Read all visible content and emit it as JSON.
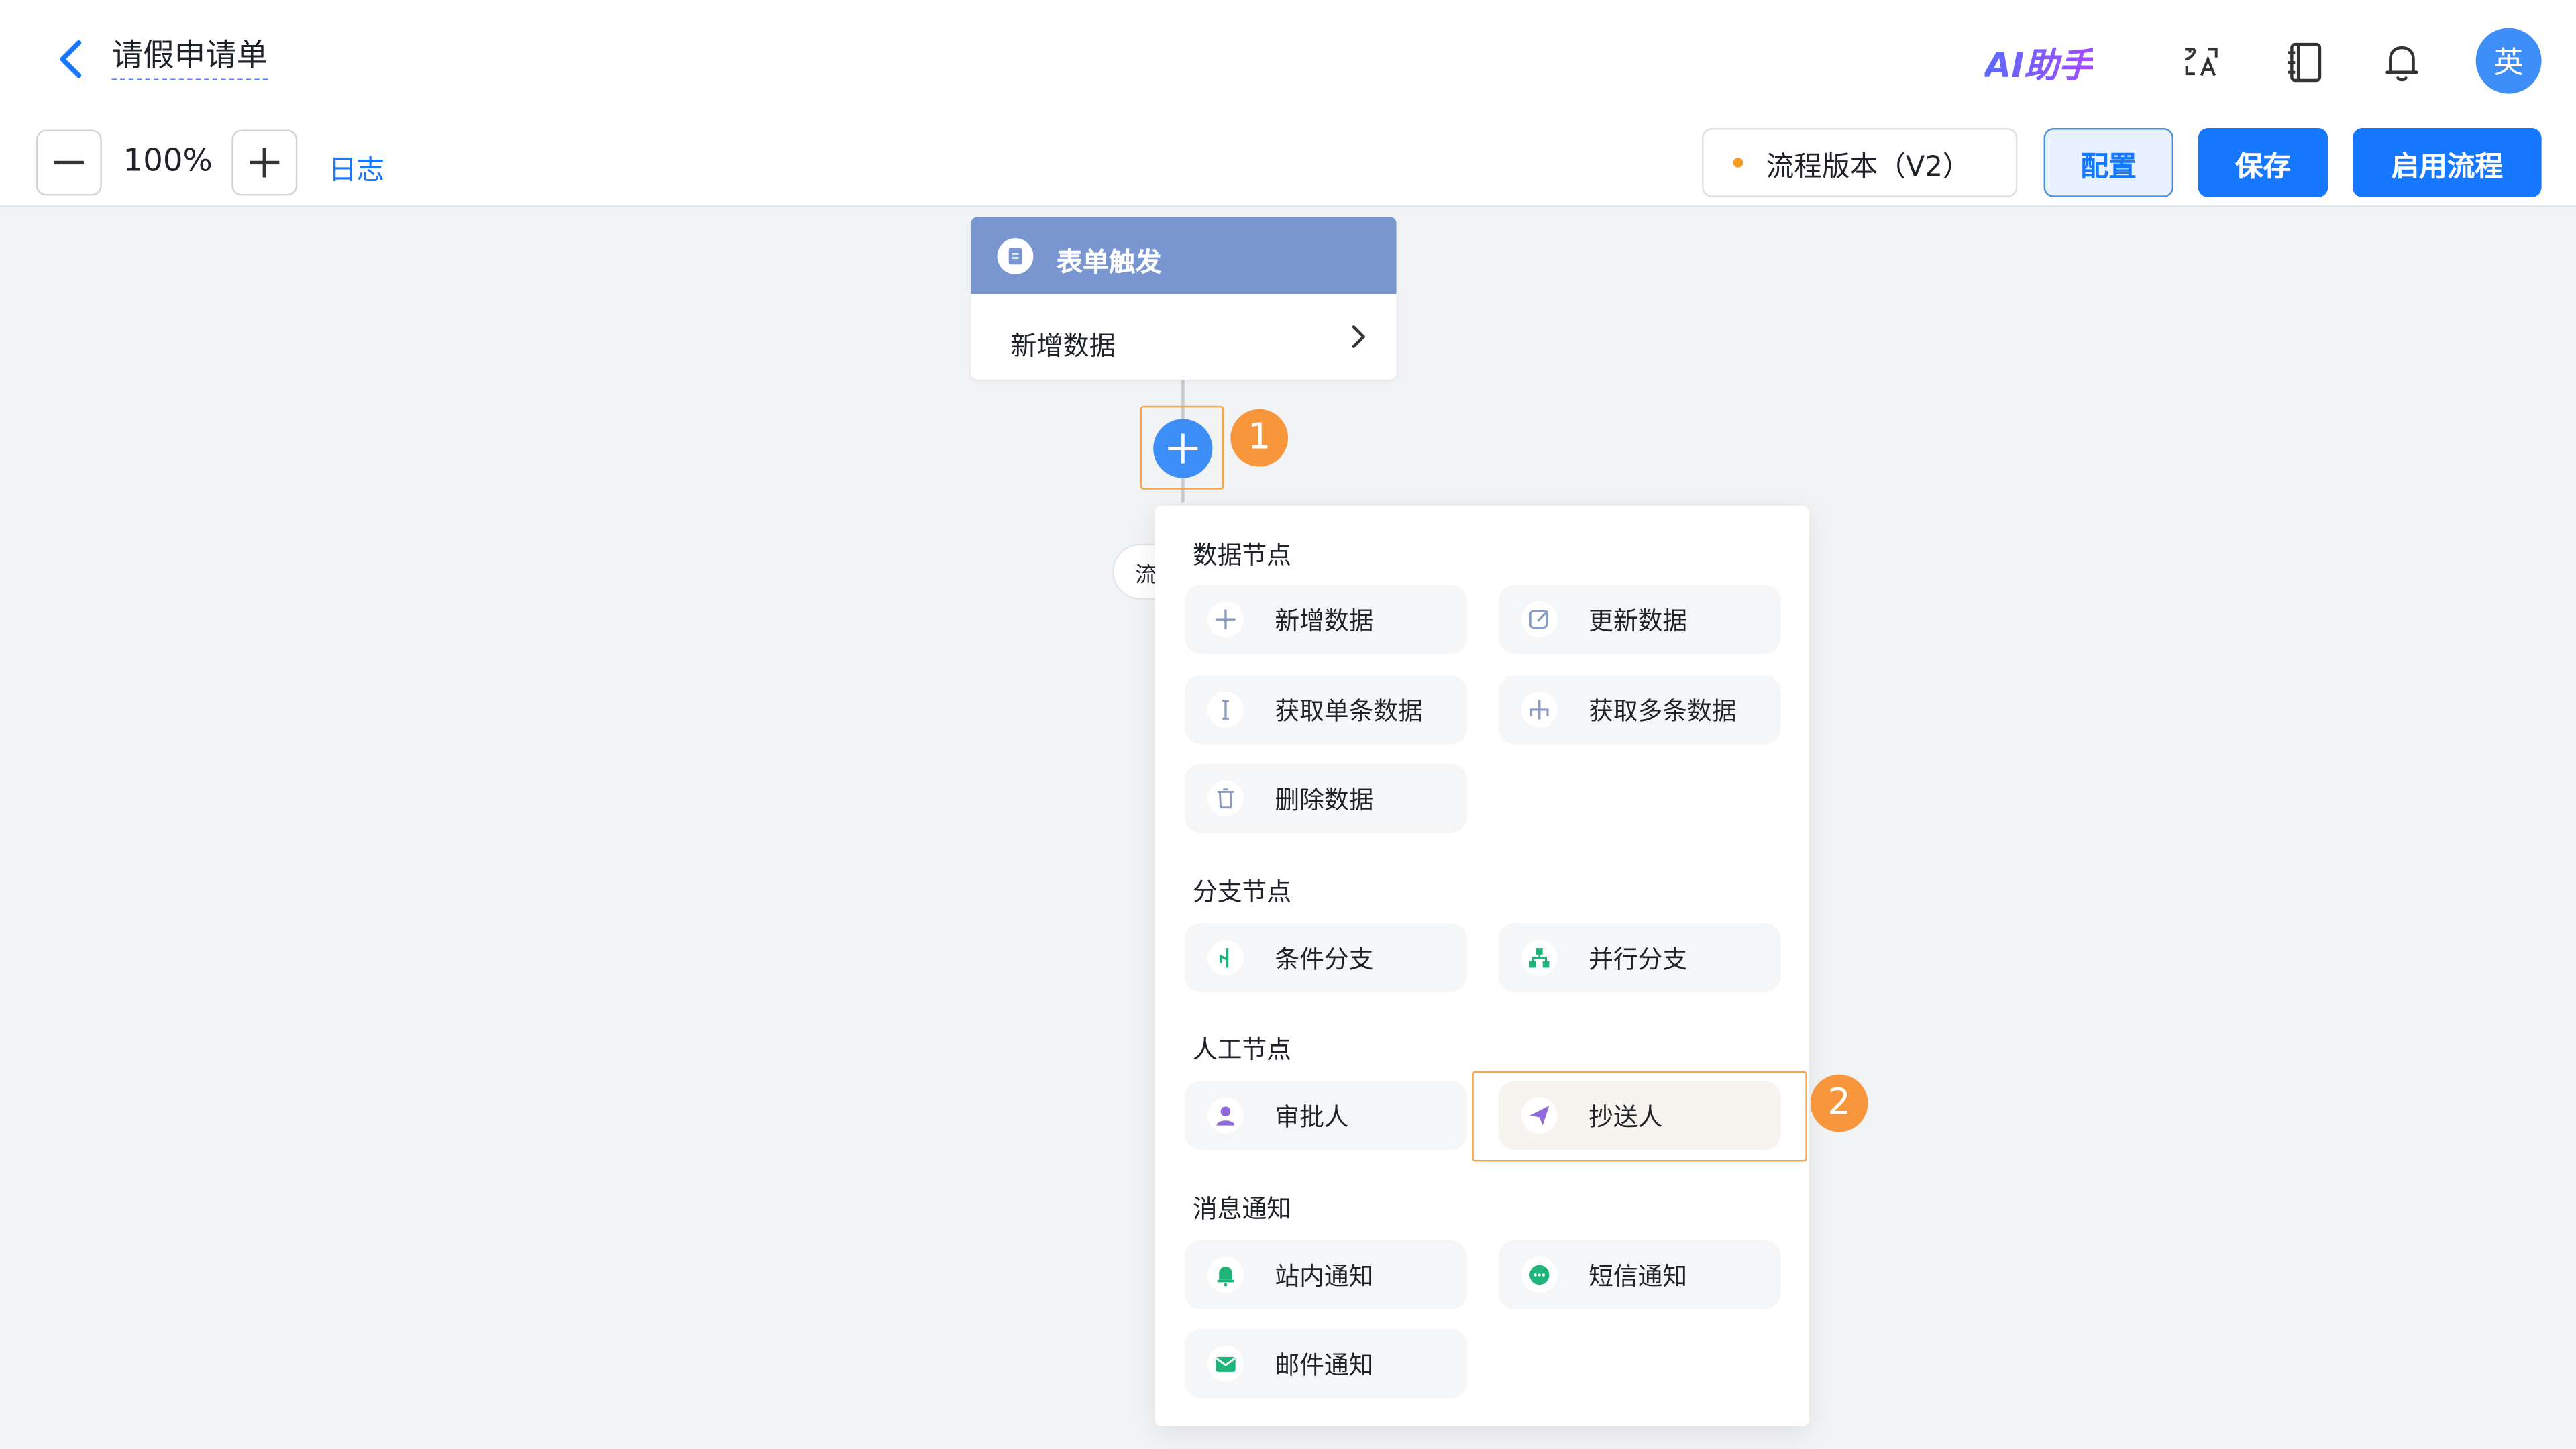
{
  "header": {
    "title": "请假申请单",
    "ai_assistant": "AI助手",
    "avatar_text": "英"
  },
  "toolbar": {
    "zoom_level": "100%",
    "log_label": "日志",
    "version_label": "流程版本（V2）",
    "config_label": "配置",
    "save_label": "保存",
    "enable_label": "启用流程"
  },
  "trigger_node": {
    "title": "表单触发",
    "action": "新增数据"
  },
  "annotations": {
    "step1": "1",
    "step2": "2"
  },
  "hidden_pill_text": "流",
  "menu": {
    "sections": [
      {
        "title": "数据节点",
        "items": [
          {
            "label": "新增数据",
            "icon": "plus-icon"
          },
          {
            "label": "更新数据",
            "icon": "edit-icon"
          },
          {
            "label": "获取单条数据",
            "icon": "single-line-icon"
          },
          {
            "label": "获取多条数据",
            "icon": "multi-branch-icon"
          },
          {
            "label": "删除数据",
            "icon": "trash-icon"
          }
        ]
      },
      {
        "title": "分支节点",
        "items": [
          {
            "label": "条件分支",
            "icon": "condition-branch-icon"
          },
          {
            "label": "并行分支",
            "icon": "parallel-branch-icon"
          }
        ]
      },
      {
        "title": "人工节点",
        "items": [
          {
            "label": "审批人",
            "icon": "user-icon"
          },
          {
            "label": "抄送人",
            "icon": "send-icon"
          }
        ]
      },
      {
        "title": "消息通知",
        "items": [
          {
            "label": "站内通知",
            "icon": "bell-icon"
          },
          {
            "label": "短信通知",
            "icon": "chat-icon"
          },
          {
            "label": "邮件通知",
            "icon": "mail-icon"
          }
        ]
      }
    ]
  },
  "colors": {
    "primary": "#1677ff",
    "trigger_header": "#7a96d0",
    "highlight": "#f7a54a",
    "data_icon": "#8a9bc4",
    "branch_icon": "#1fb47a",
    "manual_icon": "#8e6bd8",
    "notify_icon": "#1fb47a"
  }
}
